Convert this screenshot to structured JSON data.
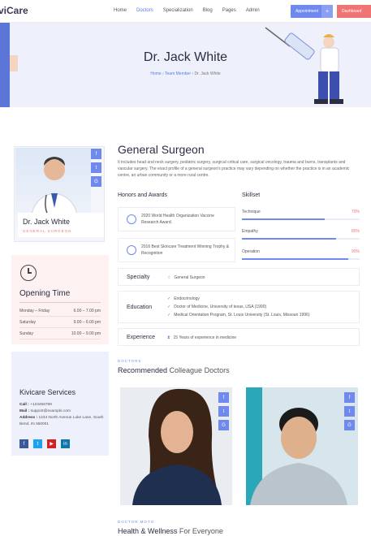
{
  "nav": {
    "logo": "viCare",
    "links": [
      "Home",
      "Doctors",
      "Specialization",
      "Blog",
      "Pages",
      "Admin"
    ],
    "appointment_label": "Appointment",
    "dashboard_label": "Dashboard"
  },
  "hero": {
    "title": "Dr. Jack White",
    "breadcrumb": [
      "Home",
      "Team Member",
      "Dr. Jack White"
    ]
  },
  "doctor": {
    "name": "Dr. Jack White",
    "role": "GENERAL SURGEON"
  },
  "opening": {
    "title": "Opening Time",
    "rows": [
      {
        "day": "Monday – Friday",
        "time": "6.00 – 7.00 pm"
      },
      {
        "day": "Saturday",
        "time": "9.00 – 6.00 pm"
      },
      {
        "day": "Sunday",
        "time": "10.00 – 9.00 pm"
      }
    ]
  },
  "services": {
    "title": "Kivicare Services",
    "call_label": "Call :",
    "call": "+123456789",
    "mail_label": "Mail :",
    "mail": "support@example.com",
    "address_label": "Address :",
    "address": "1234 North Avenue Luke Lane, South Bend, IN 360001"
  },
  "main": {
    "title_a": "General",
    "title_b": " Surgeon",
    "intro": "It includes head and neck surgery, pediatric surgery, surgical critical care, surgical oncology, trauma and burns, transplants and vascular surgery. The exact profile of a general surgeon's practice may vary depending on whether the practice is in an academic centre, an urban community or a more rural centre.",
    "honors_title": "Honors and Awards",
    "skillset_title": "Skillset",
    "awards": [
      "2020 World Health Organization Vaccine Research Award.",
      "2016 Best Skincare Treatment Winning Trophy & Recognition"
    ],
    "skills": [
      {
        "name": "Technique",
        "percent": 70,
        "label": "70%"
      },
      {
        "name": "Empathy",
        "percent": 80,
        "label": "80%"
      },
      {
        "name": "Operation",
        "percent": 90,
        "label": "90%"
      }
    ],
    "specialty_label": "Specialty",
    "specialty_value": "General Surgeon",
    "education_label": "Education",
    "education": [
      "Endocrinology",
      "Doctor of Medicine, University of texas, USA (1990)",
      "Medical Orientation Program, St. Louis University (St. Louis, Missouri 1996)"
    ],
    "experience_label": "Experience",
    "experience_value": "15 Years of experience in medicine"
  },
  "recommended": {
    "eyebrow": "DOCTORS",
    "title_a": "Recommended",
    "title_b": " Colleague Doctors"
  },
  "motto": {
    "eyebrow": "DOCTOR MOTO",
    "title_a": "Health & Wellness",
    "title_b": " For Everyone"
  },
  "colors": {
    "accent": "#6f89ee",
    "danger": "#f07474",
    "hero_bg": "#eef1fb"
  }
}
